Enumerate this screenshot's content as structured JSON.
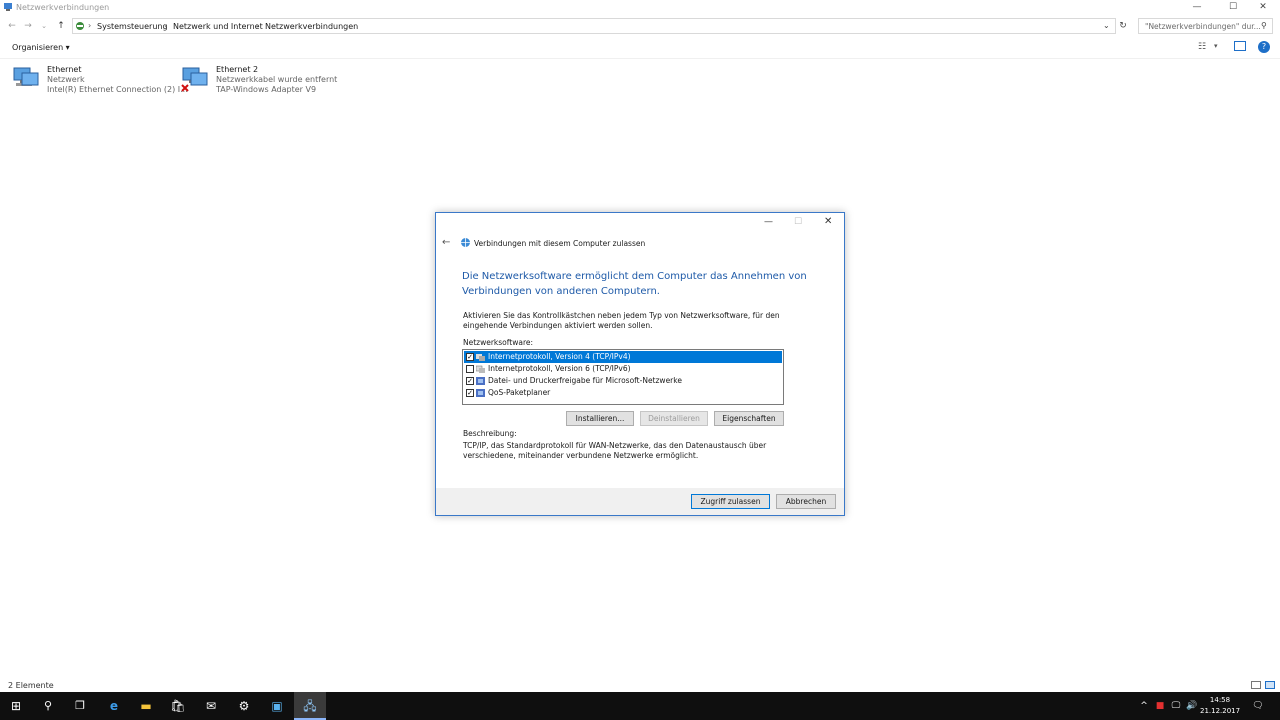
{
  "window": {
    "title": "Netzwerkverbindungen"
  },
  "address": {
    "crumbs": [
      "Systemsteuerung",
      "Netzwerk und Internet",
      "Netzwerkverbindungen"
    ],
    "search_placeholder": "\"Netzwerkverbindungen\" dur..."
  },
  "commandbar": {
    "organize_label": "Organisieren ▾"
  },
  "connections": [
    {
      "name": "Ethernet",
      "status": "Netzwerk",
      "adapter": "Intel(R) Ethernet Connection (2) I..."
    },
    {
      "name": "Ethernet 2",
      "status": "Netzwerkkabel wurde entfernt",
      "adapter": "TAP-Windows Adapter V9"
    }
  ],
  "statusbar": {
    "count": "2 Elemente"
  },
  "dialog": {
    "title": "Verbindungen mit diesem Computer zulassen",
    "heading": "Die Netzwerksoftware ermöglicht dem Computer das Annehmen von Verbindungen von anderen Computern.",
    "intro": "Aktivieren Sie das Kontrollkästchen neben jedem Typ von Netzwerksoftware, für den eingehende Verbindungen aktiviert werden sollen.",
    "software_label": "Netzwerksoftware:",
    "software": [
      {
        "label": "Internetprotokoll, Version 4 (TCP/IPv4)",
        "checked": true,
        "selected": true
      },
      {
        "label": "Internetprotokoll, Version 6 (TCP/IPv6)",
        "checked": false,
        "selected": false
      },
      {
        "label": "Datei- und Druckerfreigabe für Microsoft-Netzwerke",
        "checked": true,
        "selected": false
      },
      {
        "label": "QoS-Paketplaner",
        "checked": true,
        "selected": false
      }
    ],
    "install_label": "Installieren...",
    "uninstall_label": "Deinstallieren",
    "properties_label": "Eigenschaften",
    "description_label": "Beschreibung:",
    "description": "TCP/IP, das Standardprotokoll für WAN-Netzwerke, das den Datenaustausch über verschiedene, miteinander verbundene Netzwerke ermöglicht.",
    "allow_label": "Zugriff zulassen",
    "cancel_label": "Abbrechen"
  },
  "taskbar": {
    "time": "14:58",
    "date": "21.12.2017"
  },
  "colors": {
    "accent": "#0078d7",
    "heading": "#1e5aa8",
    "taskbar": "#0f0f0f"
  }
}
